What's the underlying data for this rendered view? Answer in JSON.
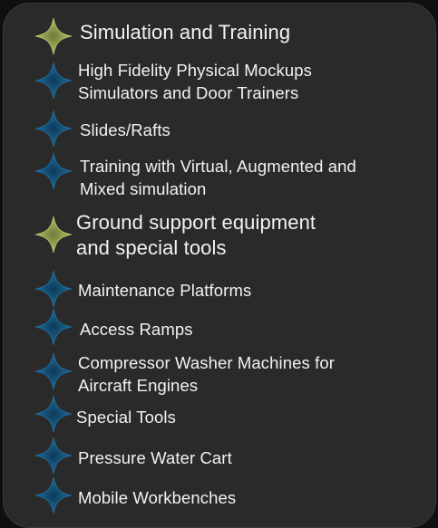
{
  "colors": {
    "panel": "#2a2a2b",
    "text": "#f2f2f2",
    "heading_star": "#b8c466",
    "item_star": "#1f6e9e"
  },
  "items": [
    {
      "kind": "heading",
      "icon": "yellow-star-icon",
      "lines": [
        "Simulation and Training"
      ]
    },
    {
      "kind": "sub",
      "icon": "blue-star-icon",
      "lines": [
        "High Fidelity Physical Mockups",
        "Simulators and Door Trainers"
      ]
    },
    {
      "kind": "sub",
      "icon": "blue-star-icon",
      "lines": [
        "Slides/Rafts"
      ]
    },
    {
      "kind": "sub",
      "icon": "blue-star-icon",
      "lines": [
        "Training with Virtual, Augmented and",
        "Mixed simulation"
      ]
    },
    {
      "kind": "heading",
      "icon": "yellow-star-icon",
      "lines": [
        "Ground support equipment",
        "and special tools"
      ]
    },
    {
      "kind": "sub",
      "icon": "blue-star-icon",
      "lines": [
        "Maintenance Platforms"
      ]
    },
    {
      "kind": "sub",
      "icon": "blue-star-icon",
      "lines": [
        "Access Ramps"
      ]
    },
    {
      "kind": "sub",
      "icon": "blue-star-icon",
      "lines": [
        "Compressor Washer Machines for",
        "Aircraft Engines"
      ]
    },
    {
      "kind": "sub",
      "icon": "blue-star-icon",
      "lines": [
        "Special Tools"
      ]
    },
    {
      "kind": "sub",
      "icon": "blue-star-icon",
      "lines": [
        "Pressure Water Cart"
      ]
    },
    {
      "kind": "sub",
      "icon": "blue-star-icon",
      "lines": [
        "Mobile Workbenches"
      ]
    }
  ]
}
